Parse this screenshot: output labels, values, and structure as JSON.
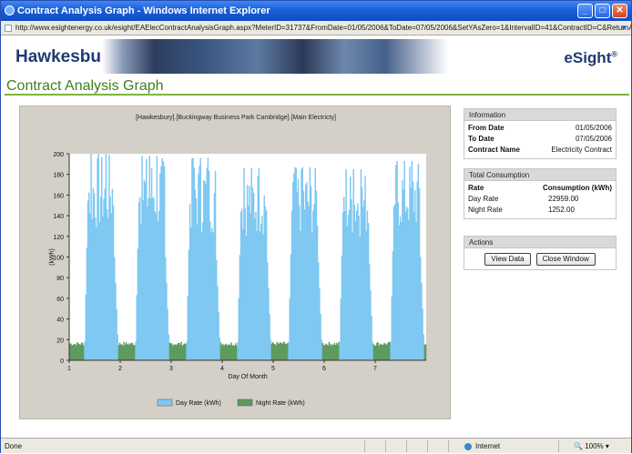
{
  "window": {
    "title": "Contract Analysis Graph - Windows Internet Explorer",
    "url": "http://www.esightenergy.co.uk/esight/EAElecContractAnalysisGraph.aspx?MeterID=31737&FromDate=01/05/2006&ToDate=07/05/2006&SetYAsZero=1&IntervalID=41&ContractID=C&ReturnAp"
  },
  "banner": {
    "logo": "Hawkesbury",
    "brand": "eSight",
    "reg": "®"
  },
  "page": {
    "heading": "Contract Analysis Graph"
  },
  "chart_data": {
    "type": "bar",
    "title": "[Hawkesbury].[Buckingway Business Park Cambridge].[Main Electricty]",
    "xlabel": "Day Of Month",
    "ylabel": "(kWh)",
    "ylim": [
      0,
      200
    ],
    "yticks": [
      "0",
      "20",
      "40",
      "60",
      "80",
      "100",
      "120",
      "140",
      "160",
      "180",
      "200"
    ],
    "xticks": [
      "1",
      "2",
      "3",
      "4",
      "5",
      "6",
      "7"
    ],
    "grid": false,
    "legend_position": "bottom",
    "series": [
      {
        "name": "Day Rate (kWh)",
        "color": "#7ec8f2",
        "day_profile": [
          {
            "day": 1,
            "peak": 200,
            "base": 125
          },
          {
            "day": 2,
            "peak": 198,
            "base": 125
          },
          {
            "day": 3,
            "peak": 196,
            "base": 122
          },
          {
            "day": 4,
            "peak": 186,
            "base": 120
          },
          {
            "day": 5,
            "peak": 187,
            "base": 120
          },
          {
            "day": 6,
            "peak": 185,
            "base": 118
          },
          {
            "day": 7,
            "peak": 193,
            "base": 125
          }
        ],
        "off_hours_level": 18
      },
      {
        "name": "Night Rate (kWh)",
        "color": "#5e9a5e",
        "level": 14
      }
    ]
  },
  "info": {
    "title": "Information",
    "rows": [
      {
        "label": "From Date",
        "value": "01/05/2006"
      },
      {
        "label": "To Date",
        "value": "07/05/2006"
      },
      {
        "label": "Contract Name",
        "value": "Electricity Contract"
      }
    ]
  },
  "consumption": {
    "title": "Total Consumption",
    "head": {
      "label": "Rate",
      "value": "Consumption (kWh)"
    },
    "rows": [
      {
        "label": "Day Rate",
        "value": "22959.00"
      },
      {
        "label": "Night Rate",
        "value": "1252.00"
      }
    ]
  },
  "actions": {
    "title": "Actions",
    "view": "View Data",
    "close": "Close Window"
  },
  "status": {
    "left": "Done",
    "zone": "Internet",
    "zoom": "100%"
  }
}
